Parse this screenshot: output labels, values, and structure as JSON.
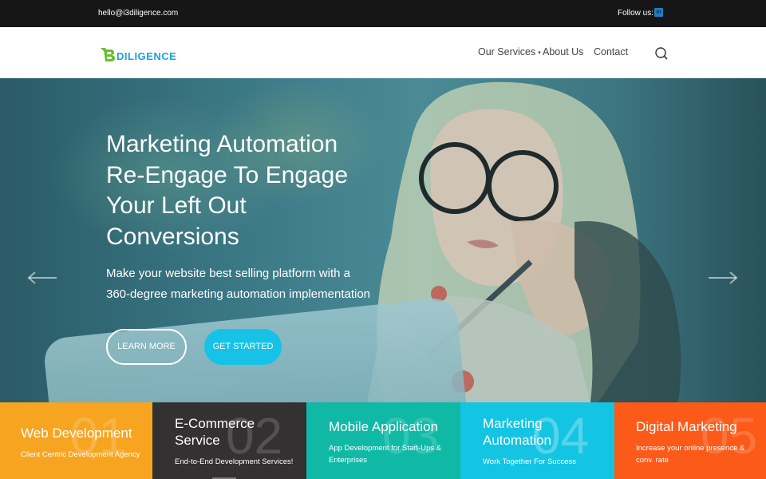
{
  "topbar": {
    "email": "hello@i3diligence.com",
    "follow_label": "Follow us:",
    "social_icon": "linkedin-icon",
    "social_glyph": "in"
  },
  "header": {
    "logo_text": "DILIGENCE",
    "nav": {
      "services": "Our Services",
      "about": "About Us",
      "contact": "Contact"
    },
    "search_icon": "search-icon"
  },
  "hero": {
    "title_lines": [
      "Marketing Automation",
      "Re-Engage To Engage",
      "Your Left Out",
      "Conversions"
    ],
    "subtitle_lines": [
      "Make your website best selling platform with a",
      "360-degree marketing automation implementation"
    ],
    "learn_more": "LEARN MORE",
    "get_started": "GET STARTED"
  },
  "tiles": [
    {
      "num": "01",
      "title": "Web Development",
      "desc": "Client Centric Development Agency",
      "color": "#f7a521"
    },
    {
      "num": "02",
      "title_lines": [
        "E-Commerce",
        "Service"
      ],
      "desc": "End-to-End Development Services!",
      "color": "#333132"
    },
    {
      "num": "03",
      "title": "Mobile Application",
      "desc_lines": [
        "App Development for Start-Ups &",
        "Enterprises"
      ],
      "color": "#0fb9a6"
    },
    {
      "num": "04",
      "title_lines": [
        "Marketing",
        "Automation"
      ],
      "desc": "Work Together For Success",
      "color": "#14c4e3"
    },
    {
      "num": "05",
      "title": "Digital Marketing",
      "desc_lines": [
        "Increase your online presence &",
        "conv. rate"
      ],
      "color": "#fb5a18"
    }
  ],
  "colors": {
    "accent": "#16c3e6",
    "topbar": "#161616",
    "logo": "#1da1e0",
    "logo_mark": "#6abf2e"
  }
}
